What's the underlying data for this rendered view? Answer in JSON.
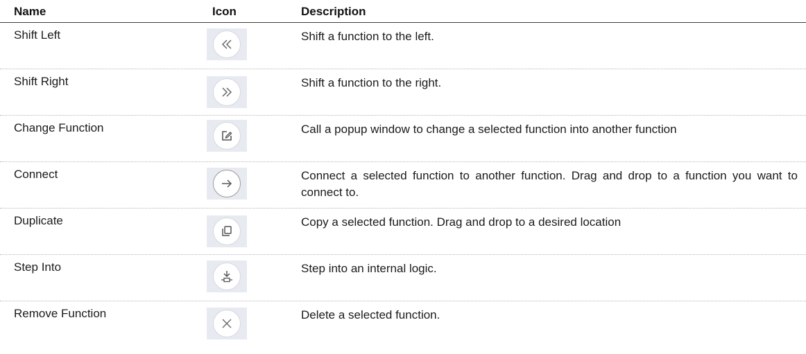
{
  "header": {
    "name": "Name",
    "icon": "Icon",
    "description": "Description"
  },
  "rows": [
    {
      "name": "Shift Left",
      "icon": "double-chevron-left-icon",
      "description": "Shift a function to the left."
    },
    {
      "name": "Shift Right",
      "icon": "double-chevron-right-icon",
      "description": "Shift a function to the right."
    },
    {
      "name": "Change Function",
      "icon": "edit-icon",
      "description": "Call a popup window to change a selected function into another function"
    },
    {
      "name": "Connect",
      "icon": "arrow-right-icon",
      "description": "Connect a selected function to another function. Drag and drop to a function you want to connect to."
    },
    {
      "name": "Duplicate",
      "icon": "copy-icon",
      "description": "Copy a selected function. Drag and drop to a desired location"
    },
    {
      "name": "Step Into",
      "icon": "step-into-icon",
      "description": "Step into an internal logic."
    },
    {
      "name": "Remove Function",
      "icon": "close-icon",
      "description": "Delete a selected function."
    }
  ]
}
